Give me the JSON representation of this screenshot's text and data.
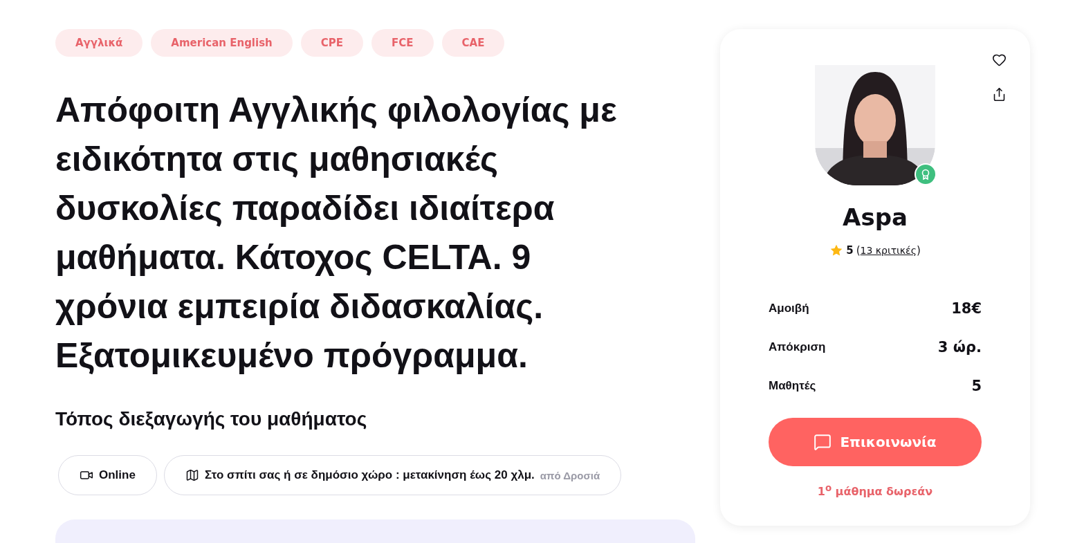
{
  "tags": [
    "Αγγλικά",
    "American English",
    "CPE",
    "FCE",
    "CAE"
  ],
  "headline": "Απόφοιτη Αγγλικής φιλολογίας με ειδικότητα στις μαθησιακές δυσκολίες παραδίδει ιδιαίτερα μαθήματα. Κάτοχος CELTA. 9 χρόνια εμπειρία διδασκαλίας. Εξατομικευμένο πρόγραμμα.",
  "location": {
    "title": "Τόπος διεξαγωγής του μαθήματος",
    "options": [
      {
        "kind": "online",
        "label": "Online"
      },
      {
        "kind": "home",
        "label": "Στο σπίτι σας ή σε δημόσιο χώρο : μετακίνηση έως 20 χλμ.",
        "note": "από Δροσιά"
      }
    ]
  },
  "profile": {
    "name": "Aspa",
    "rating": "5",
    "reviews_open": "(",
    "reviews": "13 κριτικές",
    "reviews_close": ")",
    "stats": [
      {
        "label": "Αμοιβή",
        "value": "18€"
      },
      {
        "label": "Απόκριση",
        "value": "3 ώρ."
      },
      {
        "label": "Μαθητές",
        "value": "5"
      }
    ],
    "contact_button": "Επικοινωνία",
    "free_lesson": "1$^{ο}$ μάθημα δωρεάν"
  }
}
